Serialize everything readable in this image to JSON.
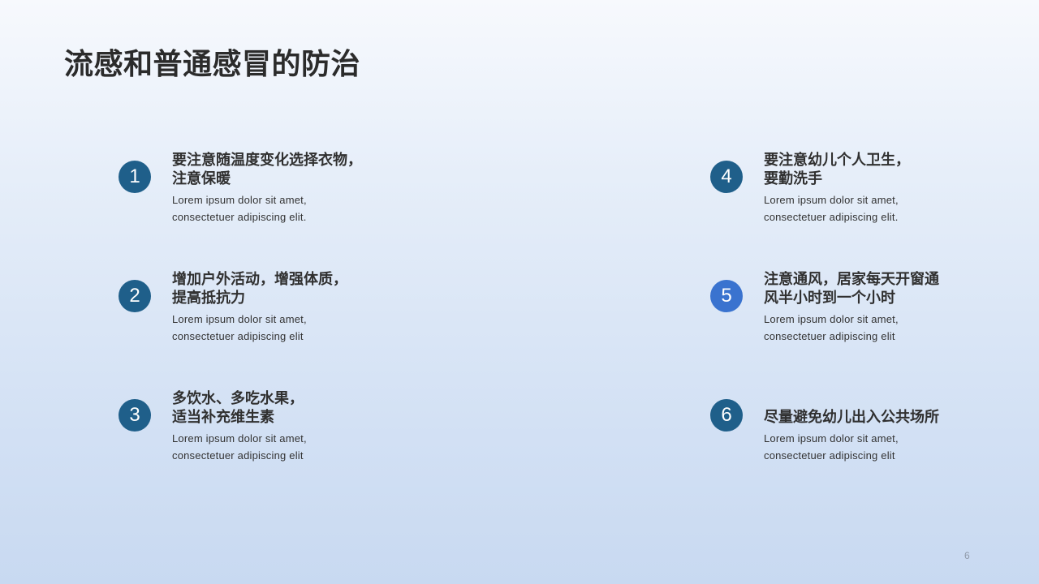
{
  "slide": {
    "title": "流感和普通感冒的防治",
    "page_number": "6"
  },
  "items": [
    {
      "number": "1",
      "heading_lines": [
        "要注意随温度变化选择衣物，",
        "注意保暖"
      ],
      "desc_lines": [
        "Lorem ipsum dolor sit amet,",
        "consectetuer adipiscing elit."
      ]
    },
    {
      "number": "2",
      "heading_lines": [
        "增加户外活动，增强体质，",
        "提高抵抗力"
      ],
      "desc_lines": [
        "Lorem ipsum dolor sit amet,",
        "consectetuer adipiscing elit"
      ]
    },
    {
      "number": "3",
      "heading_lines": [
        "多饮水、多吃水果，",
        "适当补充维生素"
      ],
      "desc_lines": [
        "Lorem ipsum dolor sit amet,",
        "consectetuer adipiscing elit"
      ]
    },
    {
      "number": "4",
      "heading_lines": [
        "要注意幼儿个人卫生，",
        "要勤洗手"
      ],
      "desc_lines": [
        "Lorem ipsum dolor sit amet,",
        "consectetuer adipiscing elit."
      ]
    },
    {
      "number": "5",
      "heading_lines": [
        "注意通风，居家每天开窗通",
        "风半小时到一个小时"
      ],
      "desc_lines": [
        "Lorem ipsum dolor sit amet,",
        "consectetuer adipiscing elit"
      ]
    },
    {
      "number": "6",
      "heading_lines": [
        "尽量避免幼儿出入公共场所"
      ],
      "desc_lines": [
        "Lorem ipsum dolor sit amet,",
        "consectetuer adipiscing elit"
      ]
    }
  ]
}
